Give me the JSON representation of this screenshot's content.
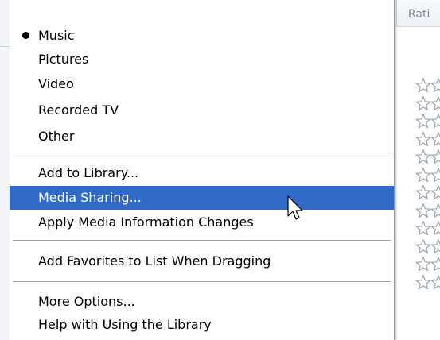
{
  "background": {
    "column_header": "Rati",
    "rating_rows": 12
  },
  "menu": {
    "items": [
      {
        "label": "Music",
        "checked": true
      },
      {
        "label": "Pictures"
      },
      {
        "label": "Video"
      },
      {
        "label": "Recorded TV"
      },
      {
        "label": "Other"
      },
      {
        "label": "Add to Library..."
      },
      {
        "label": "Media Sharing...",
        "highlighted": true
      },
      {
        "label": "Apply Media Information Changes"
      },
      {
        "label": "Add Favorites to List When Dragging"
      },
      {
        "label": "More Options..."
      },
      {
        "label": "Help with Using the Library"
      }
    ],
    "highlight_color": "#3169c6"
  }
}
